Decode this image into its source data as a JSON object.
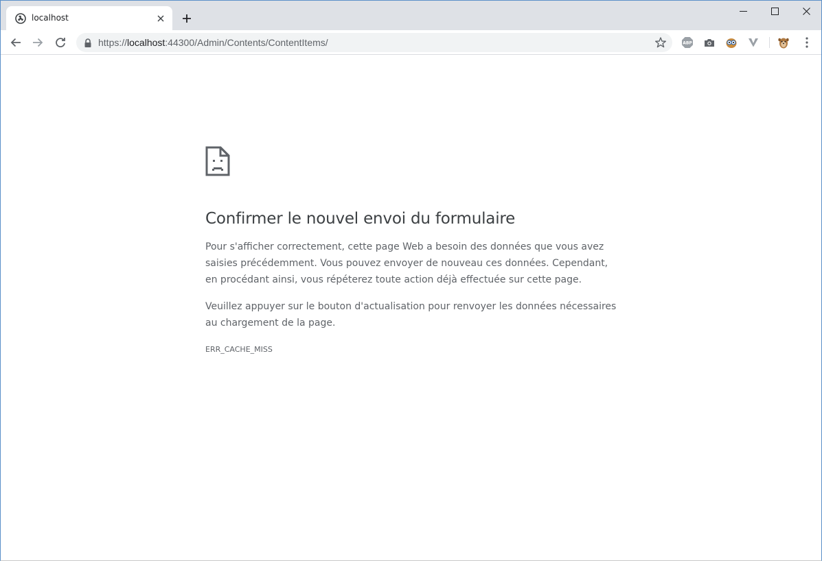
{
  "browser": {
    "tab": {
      "title": "localhost",
      "favicon": "site-favicon-icon"
    },
    "window_controls": [
      "minimize-icon",
      "maximize-icon",
      "close-icon"
    ],
    "address_bar": {
      "scheme": "https://",
      "host": "localhost",
      "rest": ":44300/Admin/Contents/ContentItems/"
    },
    "extensions": [
      "abp-icon",
      "camera-icon",
      "owl-icon",
      "v-icon",
      "avatar-icon"
    ]
  },
  "page": {
    "title": "Confirmer le nouvel envoi du formulaire",
    "paragraph1": "Pour s'afficher correctement, cette page Web a besoin des données que vous avez saisies précédemment. Vous pouvez envoyer de nouveau ces données. Cependant, en procédant ainsi, vous répéterez toute action déjà effectuée sur cette page.",
    "paragraph2": "Veuillez appuyer sur le bouton d'actualisation pour renvoyer les données nécessaires au chargement de la page.",
    "error_code": "ERR_CACHE_MISS"
  },
  "colors": {
    "tabstrip": "#dee1e6",
    "omnibox": "#f1f3f4",
    "title_text": "#3c4043",
    "body_text": "#5f6368"
  }
}
